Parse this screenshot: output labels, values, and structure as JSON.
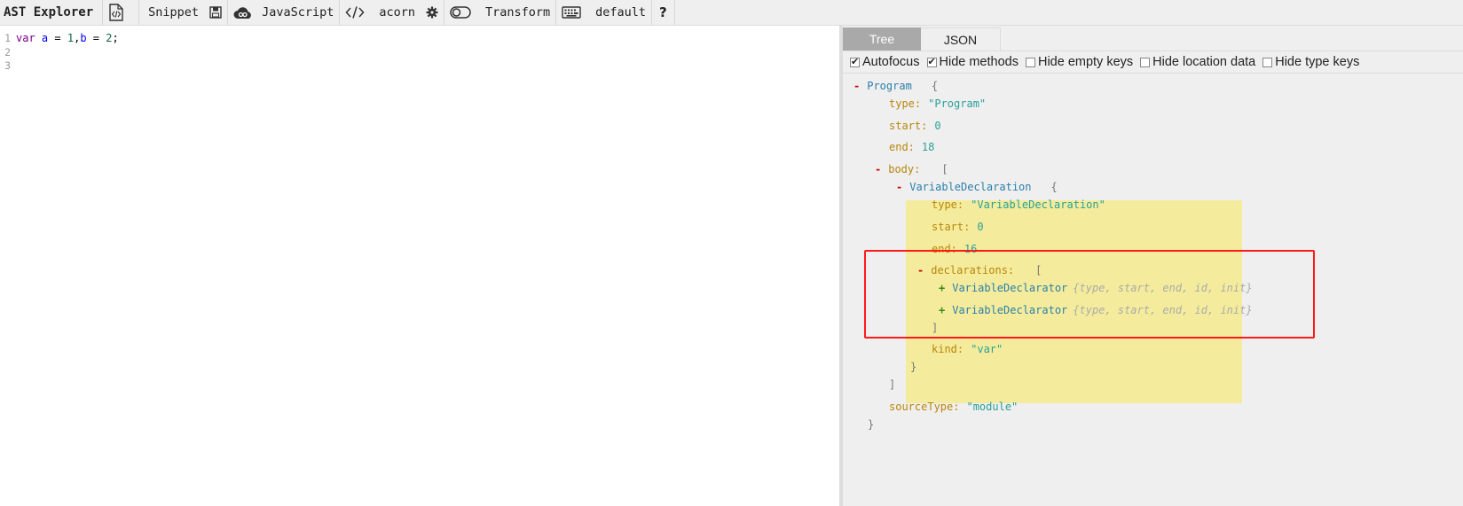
{
  "toolbar": {
    "title": "AST Explorer",
    "snippet": "Snippet",
    "language": "JavaScript",
    "parser": "acorn",
    "transform": "Transform",
    "keymap": "default",
    "help": "?"
  },
  "editor": {
    "line_numbers": [
      "1",
      "2",
      "3"
    ],
    "code": {
      "kw": "var",
      "v1": "a",
      "eq1": " = ",
      "n1": "1",
      "comma": ",",
      "v2": "b",
      "eq2": " = ",
      "n2": "2",
      "semi": ";"
    }
  },
  "panel": {
    "tabs": [
      "Tree",
      "JSON"
    ],
    "options": [
      {
        "label": "Autofocus",
        "checked": true
      },
      {
        "label": "Hide methods",
        "checked": true
      },
      {
        "label": "Hide empty keys",
        "checked": false
      },
      {
        "label": "Hide location data",
        "checked": false
      },
      {
        "label": "Hide type keys",
        "checked": false
      }
    ]
  },
  "tree": {
    "program": {
      "toggle": "-",
      "name": "Program",
      "open": "{",
      "type_key": "type:",
      "type_val": "\"Program\"",
      "start_key": "start:",
      "start_val": "0",
      "end_key": "end:",
      "end_val": "18",
      "body_toggle": "-",
      "body_key": "body:",
      "body_open": "[",
      "body_close": "]",
      "source_key": "sourceType:",
      "source_val": "\"module\"",
      "close": "}"
    },
    "vardecl": {
      "toggle": "-",
      "name": "VariableDeclaration",
      "open": "{",
      "type_key": "type:",
      "type_val": "\"VariableDeclaration\"",
      "start_key": "start:",
      "start_val": "0",
      "end_key": "end:",
      "end_val": "16",
      "decl_toggle": "-",
      "decl_key": "declarations:",
      "decl_open": "[",
      "decl_close": "]",
      "kind_key": "kind:",
      "kind_val": "\"var\"",
      "close": "}"
    },
    "declarators": [
      {
        "toggle": "+",
        "name": "VariableDeclarator",
        "summary": "{type, start, end, id, init}"
      },
      {
        "toggle": "+",
        "name": "VariableDeclarator",
        "summary": "{type, start, end, id, init}"
      }
    ]
  },
  "colors": {
    "highlight": "#f4ec9c",
    "annotation_box": "#ff1a1a",
    "active_tab": "#a9a9a9"
  }
}
